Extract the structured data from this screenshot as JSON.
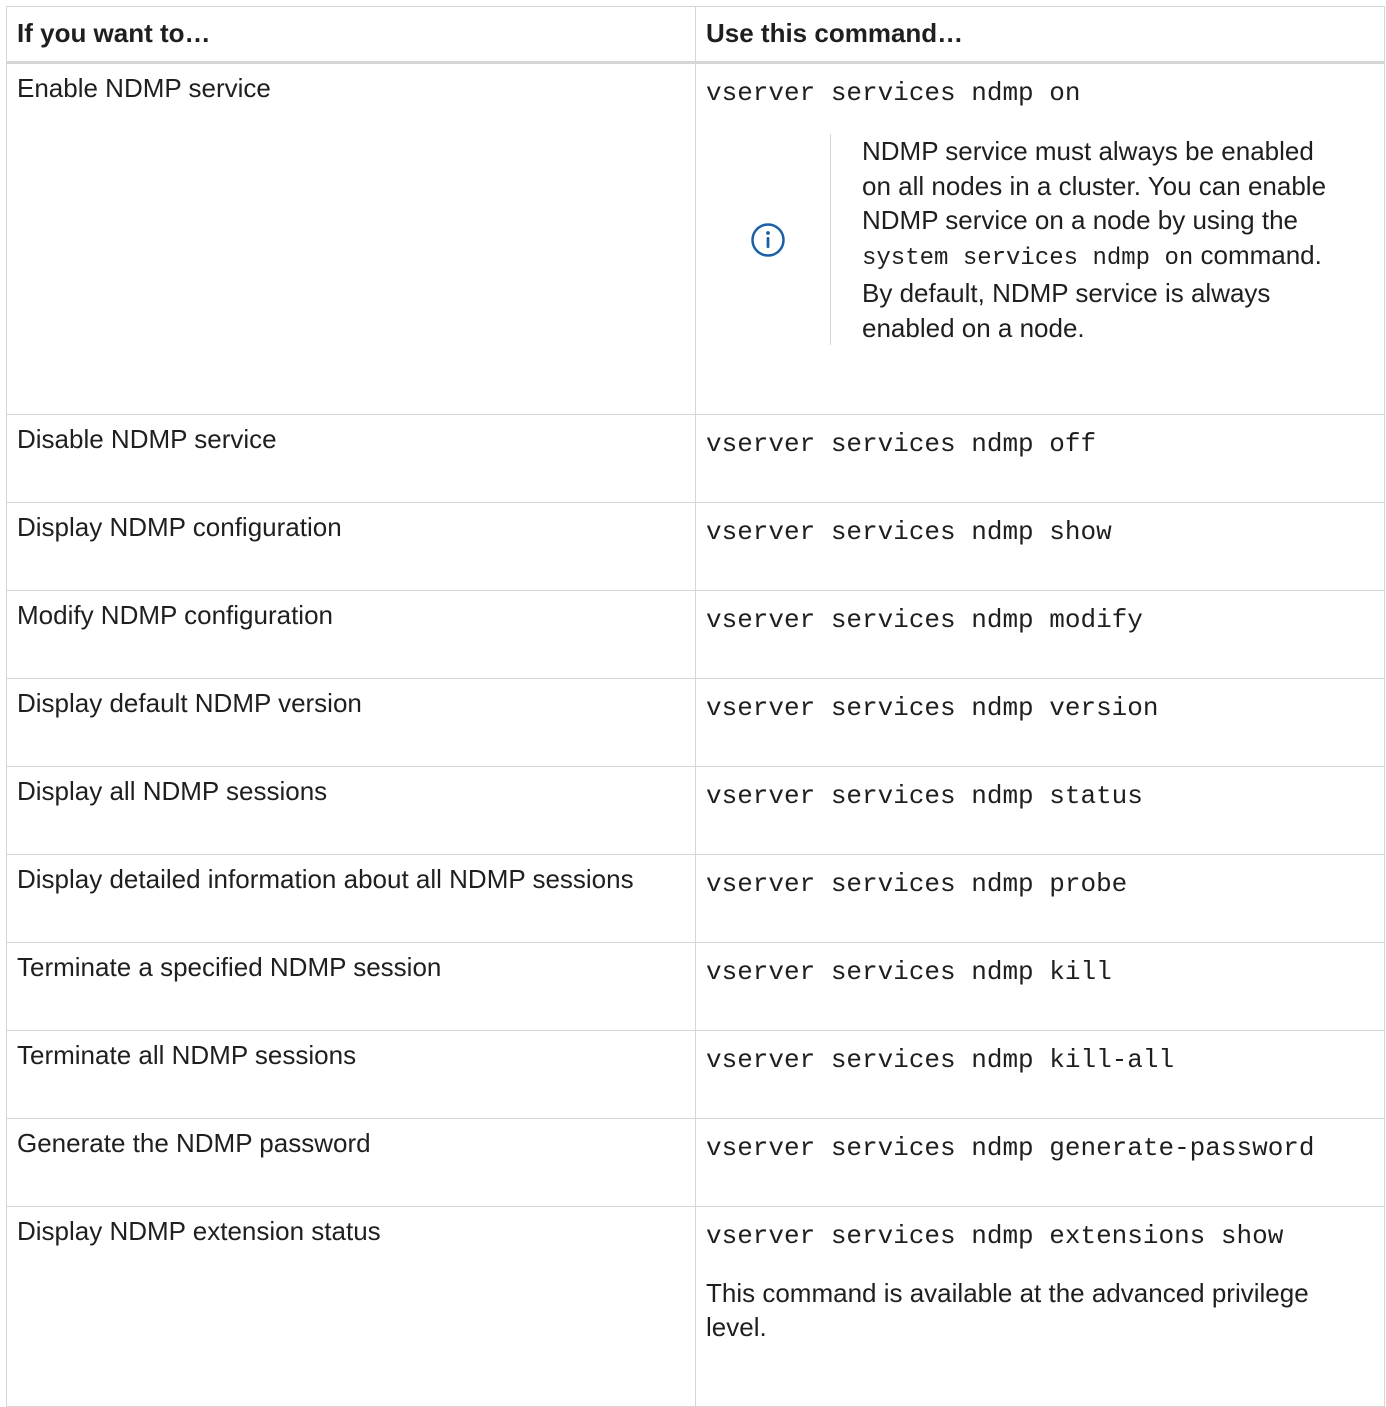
{
  "table": {
    "headers": [
      "If you want to…",
      "Use this command…"
    ],
    "rows": [
      {
        "want": "Enable NDMP service",
        "command": "vserver services ndmp on",
        "note": {
          "icon": "info-icon",
          "text_before": "NDMP service must always be enabled on all nodes in a cluster. You can enable NDMP service on a node by using the ",
          "code": "system services ndmp on",
          "text_after": " command. By default, NDMP service is always enabled on a node."
        }
      },
      {
        "want": "Disable NDMP service",
        "command": "vserver services ndmp off"
      },
      {
        "want": "Display NDMP configuration",
        "command": "vserver services ndmp show"
      },
      {
        "want": "Modify NDMP configuration",
        "command": "vserver services ndmp modify"
      },
      {
        "want": "Display default NDMP version",
        "command": "vserver services ndmp version"
      },
      {
        "want": "Display all NDMP sessions",
        "command": "vserver services ndmp status"
      },
      {
        "want": "Display detailed information about all NDMP sessions",
        "command": "vserver services ndmp probe"
      },
      {
        "want": "Terminate a specified NDMP session",
        "command": "vserver services ndmp kill"
      },
      {
        "want": "Terminate all NDMP sessions",
        "command": "vserver services ndmp kill-all"
      },
      {
        "want": "Generate the NDMP password",
        "command": "vserver services ndmp generate-password"
      },
      {
        "want": "Display NDMP extension status",
        "command": "vserver services ndmp extensions show",
        "extra": "This command is available at the advanced privilege level."
      }
    ]
  },
  "colors": {
    "border": "#d6d6d6",
    "info_icon": "#1a5fa8",
    "text": "#1f1f1f"
  }
}
